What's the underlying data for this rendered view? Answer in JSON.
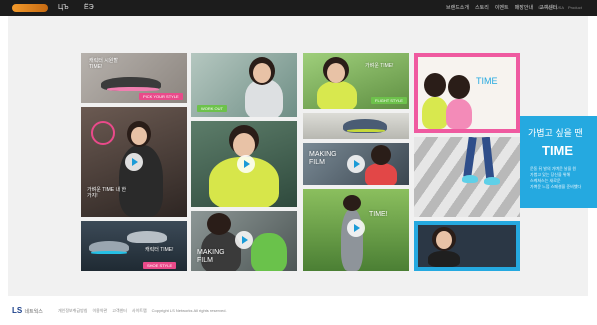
{
  "header": {
    "sub_logos": [
      "ЦЪ",
      "ЁЭ"
    ],
    "nav": [
      "브랜드소개",
      "스토리",
      "이벤트",
      "매장안내",
      "고객센터"
    ],
    "links": [
      "Skechers USA",
      "Product"
    ]
  },
  "tiles": {
    "t1": {
      "caption": "캐릭터 시원할 TIME!",
      "button": "PICK YOUR STYLE"
    },
    "t2": {
      "button": "WORK OUT"
    },
    "t3": {
      "caption": "가벼운 TIME!",
      "button": "FLIGHT STYLE"
    },
    "t4": {
      "caption": "가벼운 TIME 내 한가지!"
    },
    "t5": {
      "caption": "TIME"
    },
    "t6": {
      "caption": "MAKING FILM"
    },
    "t7": {
      "caption": "TIME!"
    },
    "t8": {
      "caption": "캐릭터 TIME!",
      "button": "SHOE STYLE"
    },
    "t9": {
      "caption": "MAKING FILM"
    }
  },
  "promo": {
    "title": "가볍고 싶을 땐",
    "brand": "TIME",
    "body": "운동 뒤 발의 가벼운 날을 원\n가볍고 있는 당신을 위해\n스케쳐스는 새로운\n가벼운 느낌 스페셜을 준비했다"
  },
  "footer": {
    "logo": "LS",
    "logo_sub": "네트웍스",
    "links": [
      "개인정보취급방침",
      "이용약관",
      "고객센터",
      "사이트맵",
      "Copyright LS Networks All rights reserved."
    ]
  },
  "colors": {
    "accent_blue": "#25a9e0",
    "pink": "#e94a8a",
    "green": "#6dc24b",
    "topbar": "#1c1c1c"
  }
}
